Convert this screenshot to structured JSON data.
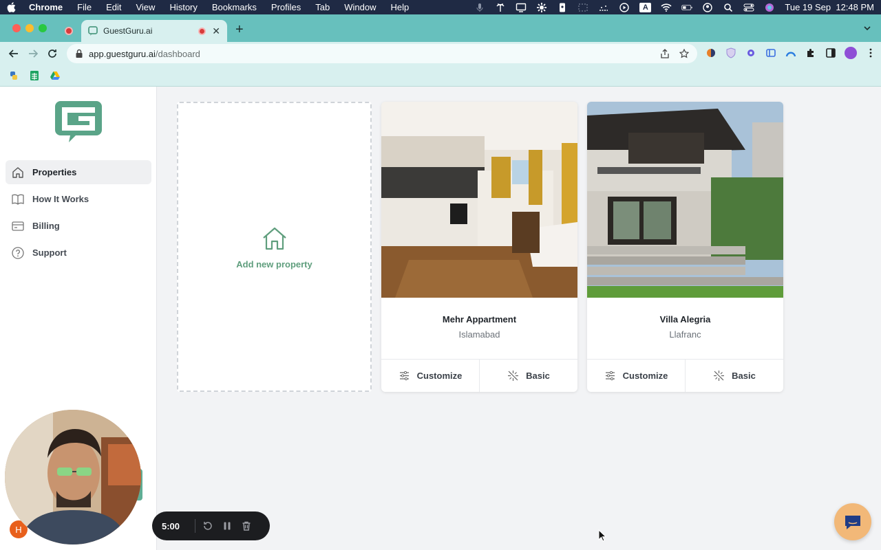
{
  "menubar": {
    "app_name": "Chrome",
    "items": [
      "File",
      "Edit",
      "View",
      "History",
      "Bookmarks",
      "Profiles",
      "Tab",
      "Window",
      "Help"
    ],
    "input_indicator": "A",
    "datetime": "Tue 19 Sep  12:48 PM"
  },
  "browser": {
    "tab_title": "GuestGuru.ai",
    "url_host": "app.guestguru.ai",
    "url_path": "/dashboard"
  },
  "sidebar": {
    "items": [
      {
        "label": "Properties",
        "icon": "home-icon",
        "active": true
      },
      {
        "label": "How It Works",
        "icon": "book-icon",
        "active": false
      },
      {
        "label": "Billing",
        "icon": "credit-card-icon",
        "active": false
      },
      {
        "label": "Support",
        "icon": "help-circle-icon",
        "active": false
      }
    ],
    "user_initial": "H"
  },
  "main": {
    "add_label": "Add new property",
    "properties": [
      {
        "name": "Mehr Appartment",
        "city": "Islamabad",
        "customize_label": "Customize",
        "mode_label": "Basic"
      },
      {
        "name": "Villa Alegria",
        "city": "Llafranc",
        "customize_label": "Customize",
        "mode_label": "Basic"
      }
    ]
  },
  "recorder": {
    "timer": "5:00"
  },
  "colors": {
    "brand_green": "#5f9e7d",
    "browser_teal": "#67c0bd",
    "chat_bubble": "#f2b878",
    "avatar_orange": "#e8601c"
  }
}
